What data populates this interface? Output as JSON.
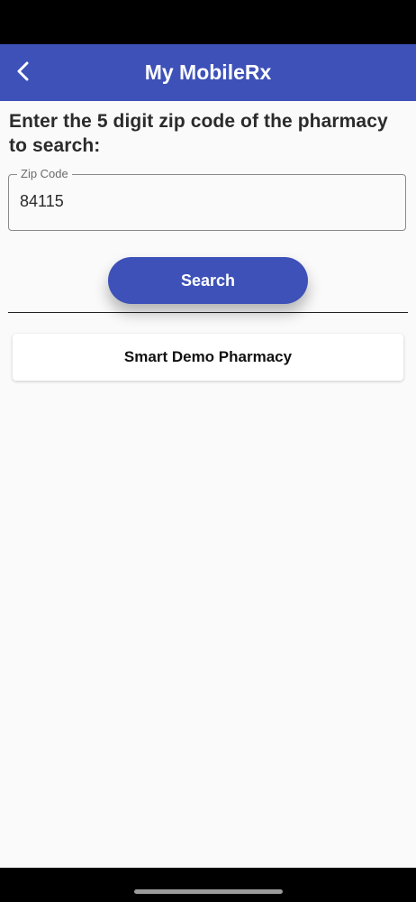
{
  "app_bar": {
    "title": "My MobileRx",
    "back_icon": "chevron-left-icon"
  },
  "search_form": {
    "prompt": "Enter the 5 digit zip code of the pharmacy to search:",
    "zip_label": "Zip Code",
    "zip_value": "84115",
    "search_label": "Search"
  },
  "results": [
    {
      "name": "Smart Demo Pharmacy"
    }
  ],
  "colors": {
    "primary": "#3d51b8",
    "background": "#fafafa",
    "card": "#ffffff",
    "text": "#2b2b2b"
  }
}
